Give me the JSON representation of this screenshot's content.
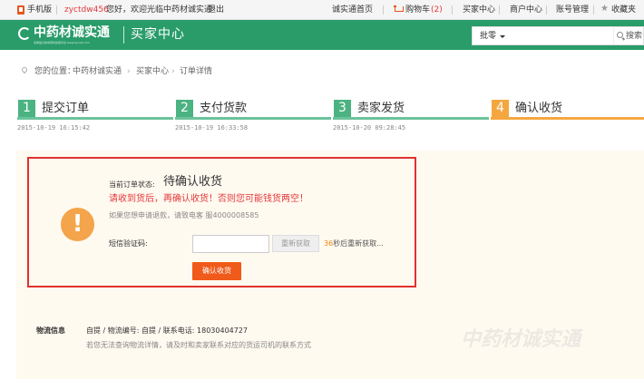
{
  "topbar": {
    "mobile": "手机版",
    "username": "zyctdw456",
    "welcome": "您好，欢迎光临中药材诚实通",
    "logout": "退出",
    "home": "诚实通首页",
    "cart_label": "购物车",
    "cart_count": "(2)",
    "buyer_center": "买家中心",
    "merchant_center": "商户中心",
    "account": "账号管理",
    "favorites": "收藏夹"
  },
  "header": {
    "logo_text": "中药材诚实通",
    "logo_sub": "全球最大的中药材交易平台 www.zyccst.com",
    "title": "买家中心",
    "search_select": "批零",
    "search_button": "搜索"
  },
  "breadcrumb": {
    "prefix": "您的位置：",
    "items": [
      "中药材诚实通",
      "买家中心",
      "订单详情"
    ]
  },
  "steps": [
    {
      "num": "1",
      "label": "提交订单",
      "time": "2015-10-19 16:15:42"
    },
    {
      "num": "2",
      "label": "支付货款",
      "time": "2015-10-19 16:33:58"
    },
    {
      "num": "3",
      "label": "卖家发货",
      "time": "2015-10-20 09:28:45"
    },
    {
      "num": "4",
      "label": "确认收货",
      "time": ""
    }
  ],
  "order": {
    "status_label": "当前订单状态:",
    "status_value": "待确认收货",
    "warning": "请收到货后，再确认收货！否则您可能钱货两空！",
    "refund_note": "如果您想申请退款，请致电客  服4000008585",
    "sms_label": "短信验证码:",
    "sms_value": "",
    "resend_label": "重新获取",
    "countdown_num": "36",
    "countdown_text": "秒后重新获取...",
    "confirm_label": "确认收货"
  },
  "logistics": {
    "label": "物流信息",
    "info": "自提 / 物流编号: 自提 / 联系电话: 18030404727",
    "note": "若您无法查询物流详情，请及时和卖家联系对应的货运司机的联系方式"
  },
  "watermark": "中药材诚实通",
  "colors": {
    "brand_green": "#299c6a",
    "step_green": "#4bb381",
    "step_orange": "#f4a73f",
    "alert_red": "#e0322e",
    "confirm_orange": "#f05a1a"
  }
}
